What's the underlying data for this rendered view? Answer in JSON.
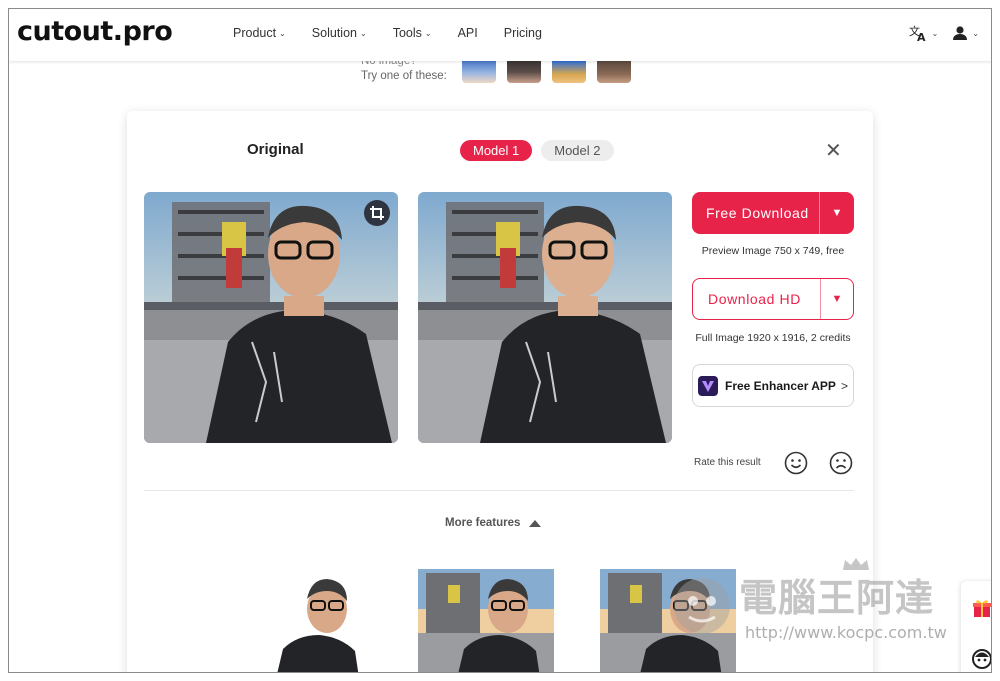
{
  "header": {
    "logo": "cutout.pro",
    "nav": [
      {
        "label": "Product",
        "has_dropdown": true
      },
      {
        "label": "Solution",
        "has_dropdown": true
      },
      {
        "label": "Tools",
        "has_dropdown": true
      },
      {
        "label": "API",
        "has_dropdown": false
      },
      {
        "label": "Pricing",
        "has_dropdown": false
      }
    ],
    "language_icon": "translate-icon",
    "user_icon": "user-icon"
  },
  "samples": {
    "no_image_text": "No image?",
    "try_text": "Try one of these:"
  },
  "panel": {
    "original_label": "Original",
    "models": [
      {
        "label": "Model 1",
        "active": true
      },
      {
        "label": "Model 2",
        "active": false
      }
    ],
    "free_download": {
      "label": "Free Download",
      "note": "Preview Image 750 x 749, free"
    },
    "download_hd": {
      "label": "Download HD",
      "note": "Full Image 1920 x 1916, 2 credits"
    },
    "enhancer": {
      "label": "Free Enhancer APP",
      "arrow": ">"
    },
    "rate_label": "Rate this result",
    "more_features": "More features"
  },
  "watermark": {
    "text": "電腦王阿達",
    "url": "http://www.kocpc.com.tw"
  },
  "colors": {
    "accent": "#e8234a",
    "text": "#222222",
    "muted": "#555555"
  }
}
